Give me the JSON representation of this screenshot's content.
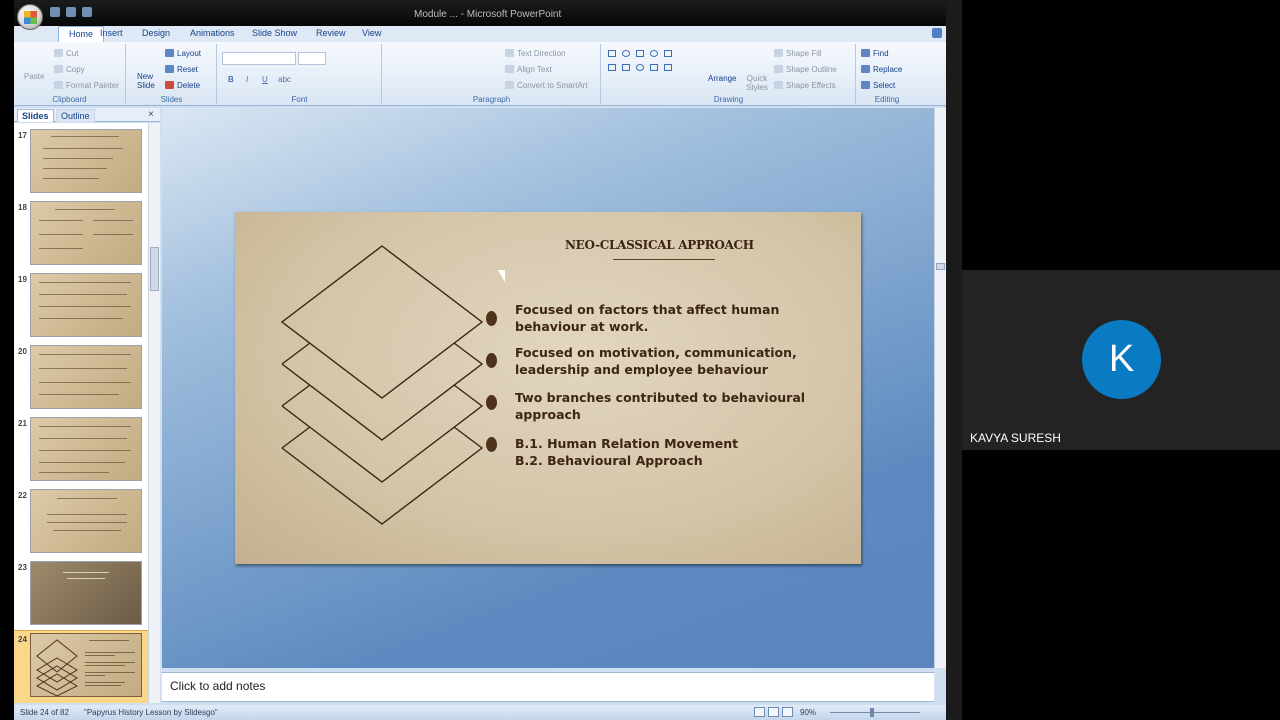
{
  "window": {
    "title": "Module ... - Microsoft PowerPoint"
  },
  "ribbon": {
    "tabs": [
      "Home",
      "Insert",
      "Design",
      "Animations",
      "Slide Show",
      "Review",
      "View"
    ],
    "clipboard": {
      "label": "Clipboard",
      "paste": "Paste",
      "cut": "Cut",
      "copy": "Copy",
      "format_painter": "Format Painter"
    },
    "slides": {
      "label": "Slides",
      "new_slide": "New Slide",
      "layout": "Layout",
      "reset": "Reset",
      "delete": "Delete"
    },
    "font": {
      "label": "Font"
    },
    "paragraph": {
      "label": "Paragraph",
      "text_direction": "Text Direction",
      "align_text": "Align Text",
      "convert_smartart": "Convert to SmartArt"
    },
    "drawing": {
      "label": "Drawing",
      "arrange": "Arrange",
      "quick_styles": "Quick Styles",
      "shape_fill": "Shape Fill",
      "shape_outline": "Shape Outline",
      "shape_effects": "Shape Effects"
    },
    "editing": {
      "label": "Editing",
      "find": "Find",
      "replace": "Replace",
      "select": "Select"
    }
  },
  "panel": {
    "tabs": [
      "Slides",
      "Outline"
    ],
    "slide_numbers": [
      "17",
      "18",
      "19",
      "20",
      "21",
      "22",
      "23",
      "24"
    ]
  },
  "slide": {
    "title": "NEO-CLASSICAL APPROACH",
    "bullets": [
      "Focused on factors that affect human behaviour at work.",
      "Focused on motivation, communication, leadership and employee behaviour",
      "Two branches contributed to behavioural approach",
      "B.1. Human Relation Movement B.2. Behavioural Approach"
    ],
    "bullet_lines": [
      [
        "Focused on factors that affect human",
        "behaviour at work."
      ],
      [
        "Focused on motivation, communication,",
        "leadership and employee behaviour"
      ],
      [
        "Two branches contributed to behavioural",
        "approach"
      ],
      [
        "B.1. Human Relation Movement",
        "B.2. Behavioural Approach"
      ]
    ]
  },
  "notes": {
    "placeholder": "Click to add notes"
  },
  "status": {
    "slide_pos": "Slide 24 of 82",
    "theme": "\"Papyrus History Lesson by Slidesgo\"",
    "zoom": "90%"
  },
  "meeting": {
    "participant_initial": "K",
    "participant_name": "KAVYA SURESH"
  }
}
